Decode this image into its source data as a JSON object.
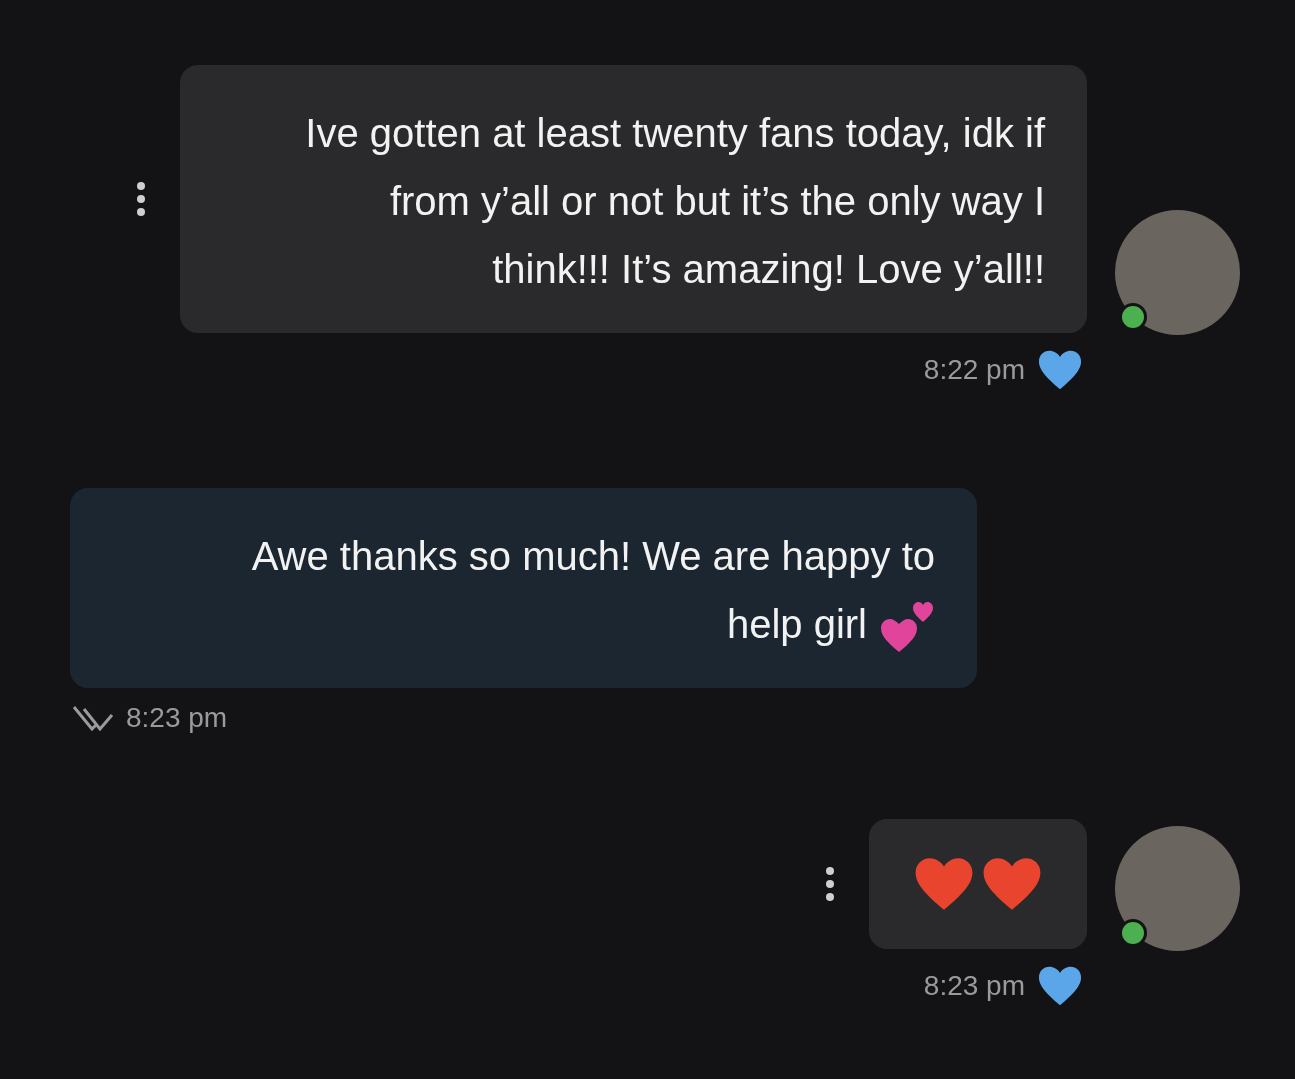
{
  "messages": [
    {
      "kind": "incoming_text",
      "text": "Ive gotten at least twenty fans today, idk if from y’all or not but it’s the only way I think!!! It’s amazing! Love y’all!!",
      "online": true,
      "time": "8:22 pm",
      "liked": true
    },
    {
      "kind": "outgoing_text_hearts",
      "text": "Awe thanks so much! We are happy to help girl",
      "time": "8:23 pm",
      "read": true
    },
    {
      "kind": "incoming_hearts",
      "online": true,
      "time": "8:23 pm",
      "liked": true
    }
  ]
}
